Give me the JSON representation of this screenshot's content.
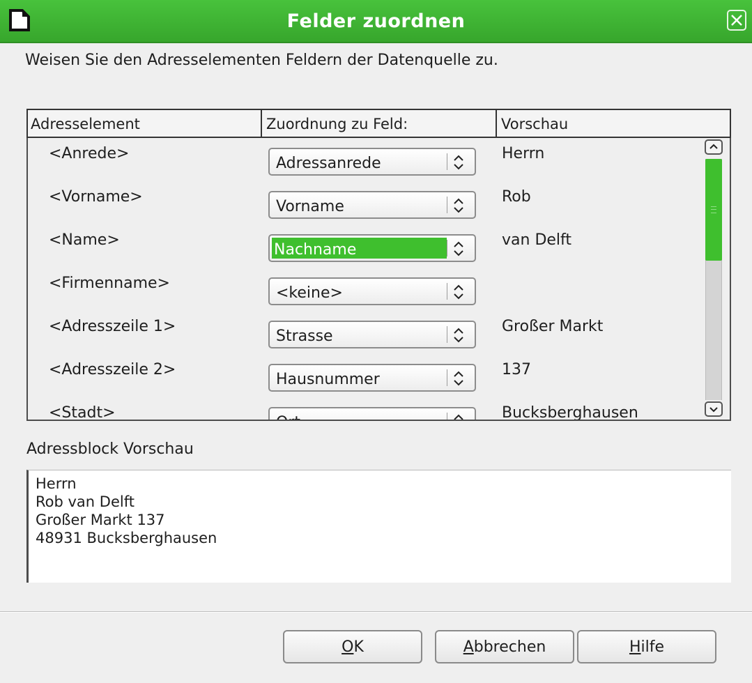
{
  "window": {
    "title": "Felder zuordnen",
    "accent": "#3fbf2e"
  },
  "instruction": "Weisen Sie den Adresselementen Feldern der Datenquelle zu.",
  "table": {
    "headers": [
      "Adresselement",
      "Zuordnung zu Feld:",
      "Vorschau"
    ],
    "rows": [
      {
        "element": "<Anrede>",
        "field": "Adressanrede",
        "preview": "Herrn"
      },
      {
        "element": "<Vorname>",
        "field": "Vorname",
        "preview": "Rob"
      },
      {
        "element": "<Name>",
        "field": "Nachname",
        "preview": "van Delft"
      },
      {
        "element": "<Firmenname>",
        "field": "<keine>",
        "preview": ""
      },
      {
        "element": "<Adresszeile 1>",
        "field": "Strasse",
        "preview": "Großer Markt"
      },
      {
        "element": "<Adresszeile 2>",
        "field": "Hausnummer",
        "preview": "137"
      },
      {
        "element": "<Stadt>",
        "field": "Ort",
        "preview": "Bucksberghausen"
      }
    ]
  },
  "preview": {
    "label": "Adressblock Vorschau",
    "lines": [
      "Herrn",
      "Rob van Delft",
      "Großer Markt 137",
      "48931 Bucksberghausen"
    ]
  },
  "buttons": {
    "ok": {
      "mnemonic": "O",
      "rest": "K"
    },
    "cancel": {
      "mnemonic": "A",
      "rest": "bbrechen"
    },
    "help": {
      "mnemonic": "H",
      "rest": "ilfe"
    }
  },
  "icons": {
    "app": "document-icon",
    "close": "close-icon",
    "spin": "spin-arrows-icon",
    "scroll_up": "chevron-up-icon",
    "scroll_down": "chevron-down-icon"
  }
}
